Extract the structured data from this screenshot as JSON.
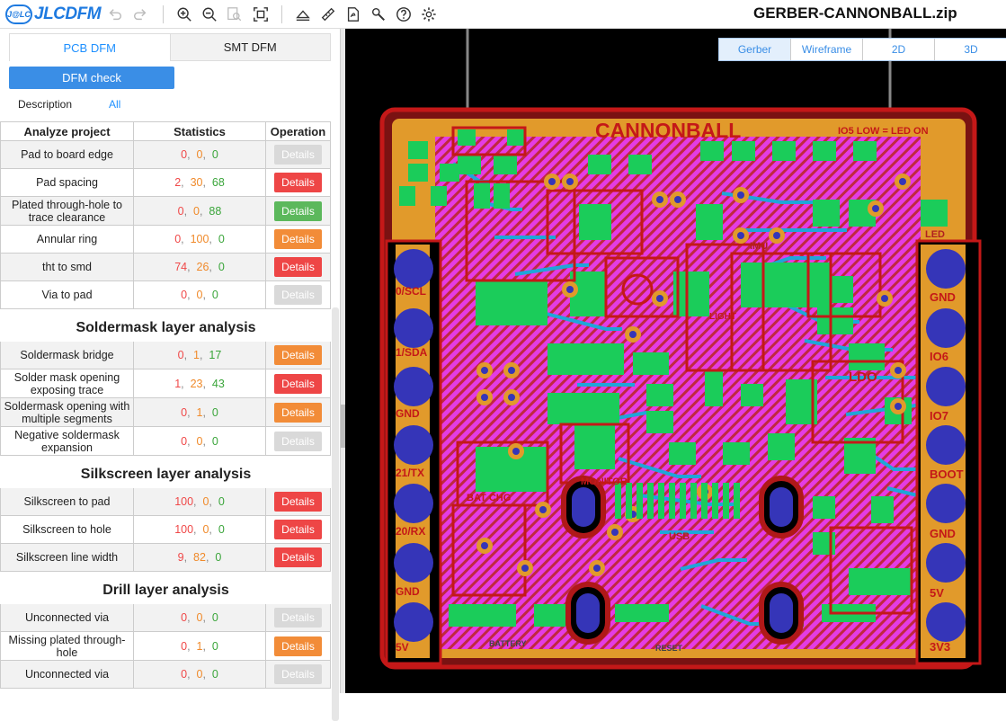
{
  "app": {
    "logo_badge": "J@LC",
    "logo_text": "JLCDFM",
    "filename": "GERBER-CANNONBALL.zip"
  },
  "toolbar": {
    "icons": [
      "undo-icon",
      "redo-icon",
      "zoom-in-icon",
      "zoom-out-icon",
      "zoom-area-icon",
      "fit-view-icon",
      "layers-icon",
      "measure-icon",
      "pdf-export-icon",
      "tools-icon",
      "help-icon",
      "settings-icon"
    ]
  },
  "tabs": [
    {
      "label": "PCB DFM",
      "active": true
    },
    {
      "label": "SMT DFM",
      "active": false
    }
  ],
  "dfm_check_label": "DFM check",
  "description_label": "Description",
  "all_label": "All",
  "table": {
    "headers": [
      "Analyze project",
      "Statistics",
      "Operation"
    ],
    "sections": [
      {
        "title": "",
        "rows": [
          {
            "name": "Pad to board edge",
            "stats": [
              "0",
              "0",
              "0"
            ],
            "button": "Details",
            "status": "gray"
          },
          {
            "name": "Pad spacing",
            "stats": [
              "2",
              "30",
              "68"
            ],
            "button": "Details",
            "status": "red"
          },
          {
            "name": "Plated through-hole to trace clearance",
            "stats": [
              "0",
              "0",
              "88"
            ],
            "button": "Details",
            "status": "green"
          },
          {
            "name": "Annular ring",
            "stats": [
              "0",
              "100",
              "0"
            ],
            "button": "Details",
            "status": "orange"
          },
          {
            "name": "tht to smd",
            "stats": [
              "74",
              "26",
              "0"
            ],
            "button": "Details",
            "status": "red"
          },
          {
            "name": "Via to pad",
            "stats": [
              "0",
              "0",
              "0"
            ],
            "button": "Details",
            "status": "gray"
          }
        ]
      },
      {
        "title": "Soldermask layer analysis",
        "rows": [
          {
            "name": "Soldermask bridge",
            "stats": [
              "0",
              "1",
              "17"
            ],
            "button": "Details",
            "status": "orange"
          },
          {
            "name": "Solder mask opening exposing trace",
            "stats": [
              "1",
              "23",
              "43"
            ],
            "button": "Details",
            "status": "red"
          },
          {
            "name": "Soldermask opening with multiple segments",
            "stats": [
              "0",
              "1",
              "0"
            ],
            "button": "Details",
            "status": "orange"
          },
          {
            "name": "Negative soldermask expansion",
            "stats": [
              "0",
              "0",
              "0"
            ],
            "button": "Details",
            "status": "gray"
          }
        ]
      },
      {
        "title": "Silkscreen layer analysis",
        "rows": [
          {
            "name": "Silkscreen to pad",
            "stats": [
              "100",
              "0",
              "0"
            ],
            "button": "Details",
            "status": "red"
          },
          {
            "name": "Silkscreen to hole",
            "stats": [
              "100",
              "0",
              "0"
            ],
            "button": "Details",
            "status": "red"
          },
          {
            "name": "Silkscreen line width",
            "stats": [
              "9",
              "82",
              "0"
            ],
            "button": "Details",
            "status": "red"
          }
        ]
      },
      {
        "title": "Drill layer analysis",
        "rows": [
          {
            "name": "Unconnected via",
            "stats": [
              "0",
              "0",
              "0"
            ],
            "button": "Details",
            "status": "gray"
          },
          {
            "name": "Missing plated through-hole",
            "stats": [
              "0",
              "1",
              "0"
            ],
            "button": "Details",
            "status": "orange"
          },
          {
            "name": "Unconnected via",
            "stats": [
              "0",
              "0",
              "0"
            ],
            "button": "Details",
            "status": "gray"
          }
        ]
      }
    ]
  },
  "view_modes": [
    {
      "label": "Gerber",
      "active": true
    },
    {
      "label": "Wireframe",
      "active": false
    },
    {
      "label": "2D",
      "active": false
    },
    {
      "label": "3D",
      "active": false
    }
  ],
  "pcb": {
    "board_title": "CANNONBALL",
    "top_note": "IO5 LOW = LED ON",
    "left_labels": [
      "0/SCL",
      "1/SDA",
      "GND",
      "21/TX",
      "20/RX",
      "GND",
      "5V"
    ],
    "right_labels": [
      "GND",
      "IO6",
      "IO7",
      "BOOT",
      "GND",
      "5V",
      "3V3"
    ],
    "misc_labels": [
      "LIGHT",
      "LDO",
      "BAT CHG",
      "MONITOR",
      "IMU",
      "LED",
      "USB",
      "BATTERY",
      "RESET"
    ],
    "colors": {
      "board_bg": "#000000",
      "copper": "#e19a2b",
      "mask": "#e43ce4",
      "pads": "#1bcc5a",
      "holes": "#3535b8",
      "outline": "#c41818",
      "silk_ref": "#1fa6d8"
    }
  }
}
